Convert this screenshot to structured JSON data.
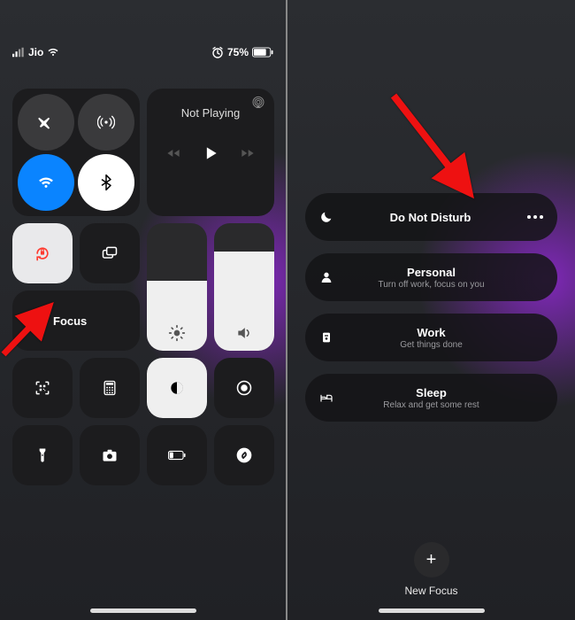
{
  "status_bar": {
    "carrier": "Jio",
    "battery_percent": "75%"
  },
  "control_center": {
    "music": {
      "title": "Not Playing"
    },
    "focus_label": "Focus",
    "tiles": {
      "airplane": "airplane-icon",
      "cellular": "cellular-icon",
      "wifi": "wifi-icon",
      "bluetooth": "bluetooth-icon",
      "orientation_lock": "orientation-lock-icon",
      "screen_mirror": "screen-mirror-icon",
      "brightness": "brightness-slider",
      "volume": "volume-slider",
      "qr": "qr-scanner-icon",
      "calculator": "calculator-icon",
      "dark_mode": "dark-mode-icon",
      "screen_record": "screen-record-icon",
      "flashlight": "flashlight-icon",
      "camera": "camera-icon",
      "low_power": "low-power-icon",
      "shazam": "shazam-icon"
    }
  },
  "focus_modes": [
    {
      "title": "Do Not Disturb",
      "subtitle": "",
      "icon": "moon"
    },
    {
      "title": "Personal",
      "subtitle": "Turn off work, focus on you",
      "icon": "person"
    },
    {
      "title": "Work",
      "subtitle": "Get things done",
      "icon": "badge"
    },
    {
      "title": "Sleep",
      "subtitle": "Relax and get some rest",
      "icon": "bed"
    }
  ],
  "new_focus_label": "New Focus"
}
